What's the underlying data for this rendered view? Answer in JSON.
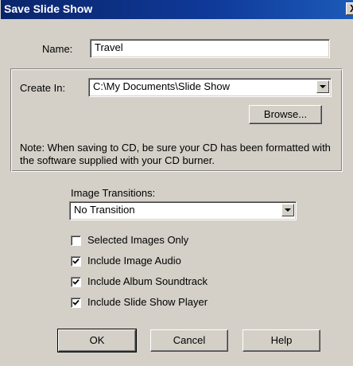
{
  "window": {
    "title": "Save Slide Show",
    "close_glyph": "X"
  },
  "name_field": {
    "label": "Name:",
    "value": "Travel"
  },
  "create_in": {
    "label": "Create In:",
    "value": "C:\\My Documents\\Slide Show",
    "browse_label": "Browse...",
    "note": "Note: When saving to CD, be sure your CD has been formatted with the software supplied with your CD burner."
  },
  "transitions": {
    "label": "Image Transitions:",
    "value": "No Transition"
  },
  "options": [
    {
      "label": "Selected Images Only",
      "checked": false
    },
    {
      "label": "Include Image Audio",
      "checked": true
    },
    {
      "label": "Include Album Soundtrack",
      "checked": true
    },
    {
      "label": "Include Slide Show Player",
      "checked": true
    }
  ],
  "buttons": {
    "ok": "OK",
    "cancel": "Cancel",
    "help": "Help"
  },
  "colors": {
    "titlebar": "#0a246a",
    "face": "#d4d0c8",
    "field": "#ffffff"
  }
}
